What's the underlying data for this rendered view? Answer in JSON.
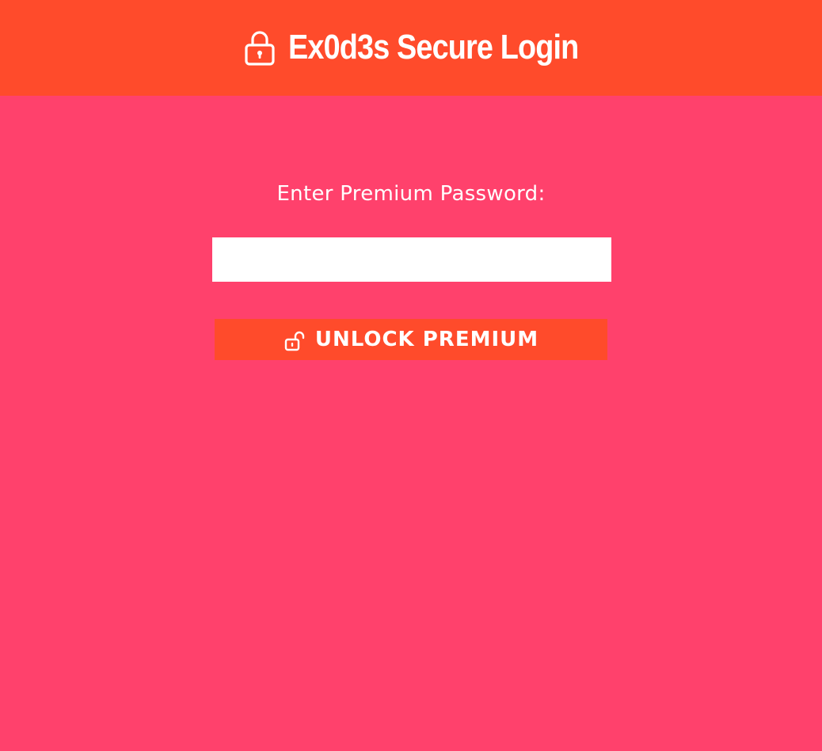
{
  "header": {
    "title": "Ex0d3s Secure Login",
    "icon": "lock-icon"
  },
  "form": {
    "label": "Enter Premium Password:",
    "password_value": "",
    "password_placeholder": "",
    "button": {
      "label": "UNLOCK PREMIUM",
      "icon": "unlock-icon"
    }
  },
  "colors": {
    "header_bg": "#ff4b2b",
    "page_bg": "#ff416c",
    "button_bg": "#ff4b2b",
    "input_bg": "#ffffff",
    "text": "#ffffff"
  }
}
